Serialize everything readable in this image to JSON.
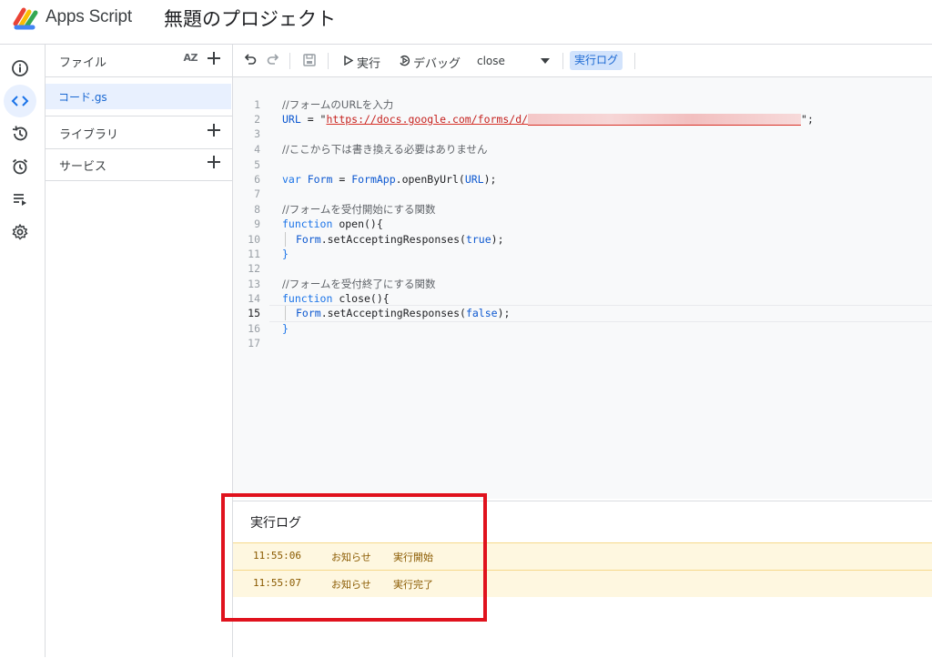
{
  "header": {
    "app_name": "Apps Script",
    "project_title": "無題のプロジェクト"
  },
  "rail": {
    "items": [
      "info-icon",
      "code-icon",
      "history-icon",
      "alarm-icon",
      "executions-icon",
      "gear-icon"
    ],
    "active": "code-icon",
    "accent": "#1a73e8"
  },
  "files_panel": {
    "files_label": "ファイル",
    "sort_label": "AZ",
    "file_name": "コード.gs",
    "libraries_label": "ライブラリ",
    "services_label": "サービス"
  },
  "toolbar": {
    "run_label": "実行",
    "debug_label": "デバッグ",
    "function_select": "close",
    "log_label": "実行ログ"
  },
  "editor": {
    "line_numbers": [
      "1",
      "2",
      "3",
      "4",
      "5",
      "6",
      "7",
      "8",
      "9",
      "10",
      "11",
      "12",
      "13",
      "14",
      "15",
      "16",
      "17"
    ],
    "current_line": "15",
    "lines": {
      "l1": "//フォームのURLを入力",
      "l2_a": "URL",
      "l2_b": " = \"",
      "l2_c": "https://docs.google.com/forms/d/",
      "l2_d": "\";",
      "l4": "//ここから下は書き換える必要はありません",
      "l6_a": "var",
      "l6_b": " Form ",
      "l6_c": "= ",
      "l6_d": "FormApp",
      "l6_e": ".openByUrl(",
      "l6_f": "URL",
      "l6_g": ");",
      "l8": "//フォームを受付開始にする関数",
      "l9_a": "function",
      "l9_b": " open(){",
      "l10_a": "Form",
      "l10_b": ".setAcceptingResponses(",
      "l10_c": "true",
      "l10_d": ");",
      "l11": "}",
      "l13": "//フォームを受付終了にする関数",
      "l14_a": "function",
      "l14_b": " close(){",
      "l15_a": "Form",
      "l15_b": ".setAcceptingResponses(",
      "l15_c": "false",
      "l15_d": ");",
      "l16": "}"
    }
  },
  "log": {
    "title": "実行ログ",
    "entries": [
      {
        "time": "11:55:06",
        "level": "お知らせ",
        "message": "実行開始"
      },
      {
        "time": "11:55:07",
        "level": "お知らせ",
        "message": "実行完了"
      }
    ]
  },
  "colors": {
    "log_row_bg": "#fef7e0",
    "highlight_border": "#e0121d"
  }
}
